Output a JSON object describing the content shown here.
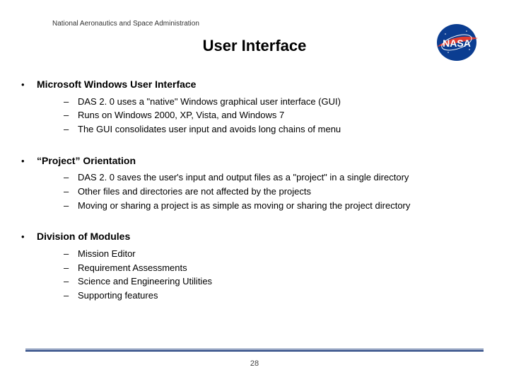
{
  "header_org": "National Aeronautics and Space Administration",
  "title": "User Interface",
  "logo_alt": "NASA",
  "sections": [
    {
      "heading": "Microsoft Windows User Interface",
      "items": [
        "DAS 2. 0 uses a \"native\" Windows graphical user interface (GUI)",
        "Runs on Windows 2000, XP, Vista, and Windows 7",
        "The GUI consolidates user input and avoids long chains of menu"
      ]
    },
    {
      "heading": "“Project” Orientation",
      "items": [
        "DAS 2. 0 saves the user's input and output files as a \"project\" in a single directory",
        "Other files and directories are not affected by the projects",
        "Moving or sharing a project is as simple as moving or sharing the project directory"
      ]
    },
    {
      "heading": "Division of Modules",
      "items": [
        "Mission Editor",
        "Requirement Assessments",
        "Science and Engineering Utilities",
        "Supporting features"
      ]
    }
  ],
  "page_number": "28",
  "colors": {
    "rule": "#1a3a7a"
  }
}
